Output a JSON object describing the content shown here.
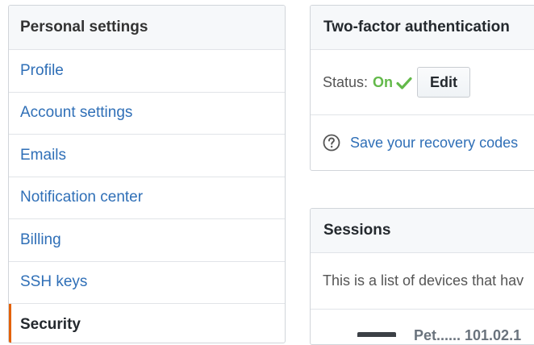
{
  "sidebar": {
    "header": "Personal settings",
    "items": [
      {
        "label": "Profile"
      },
      {
        "label": "Account settings"
      },
      {
        "label": "Emails"
      },
      {
        "label": "Notification center"
      },
      {
        "label": "Billing"
      },
      {
        "label": "SSH keys"
      },
      {
        "label": "Security",
        "selected": true
      }
    ]
  },
  "two_factor": {
    "title": "Two-factor authentication",
    "status_label": "Status:",
    "status_value": "On",
    "edit_label": "Edit",
    "recovery_link": "Save your recovery codes"
  },
  "sessions": {
    "title": "Sessions",
    "description": "This is a list of devices that hav",
    "first_session_label": "Pet...... 101.02.1"
  },
  "colors": {
    "link": "#2f6fb7",
    "status_on": "#63b94a",
    "selected_indicator": "#e36209"
  },
  "icons": {
    "status": "check-icon",
    "recovery": "question-circle-icon",
    "session": "device-icon"
  }
}
